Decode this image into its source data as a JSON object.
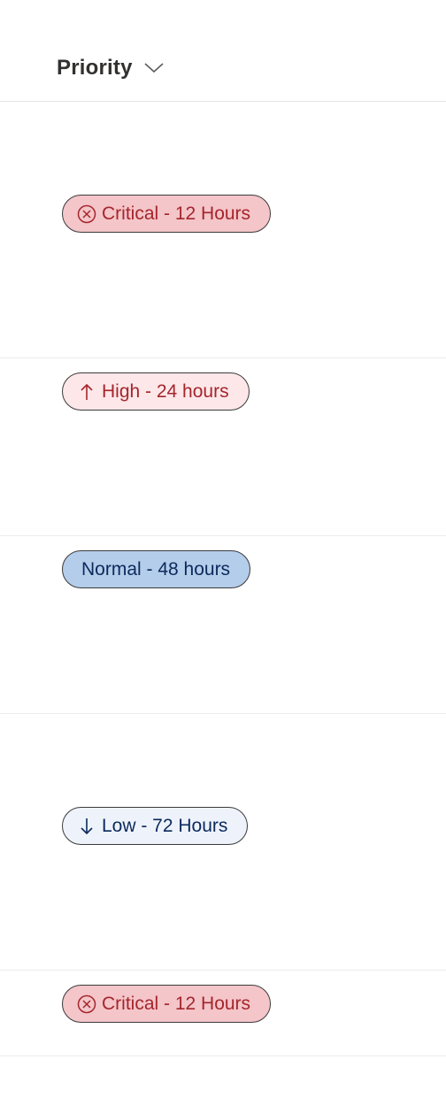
{
  "header": {
    "title": "Priority",
    "sort_icon": "chevron-down-icon"
  },
  "rows": [
    {
      "label": "Critical - 12 Hours",
      "icon": "circle-x-icon",
      "level": "critical"
    },
    {
      "label": "High - 24 hours",
      "icon": "arrow-up-icon",
      "level": "high"
    },
    {
      "label": "Normal - 48 hours",
      "icon": "",
      "level": "normal"
    },
    {
      "label": "Low - 72 Hours",
      "icon": "arrow-down-icon",
      "level": "low"
    },
    {
      "label": "Critical - 12 Hours",
      "icon": "circle-x-icon",
      "level": "critical"
    }
  ],
  "colors": {
    "critical_bg": "#f4c5c9",
    "critical_text": "#a4262c",
    "high_bg": "#fde7e9",
    "normal_bg": "#b4cdea",
    "normal_text": "#0b2a5c",
    "low_bg": "#eef3fb"
  }
}
